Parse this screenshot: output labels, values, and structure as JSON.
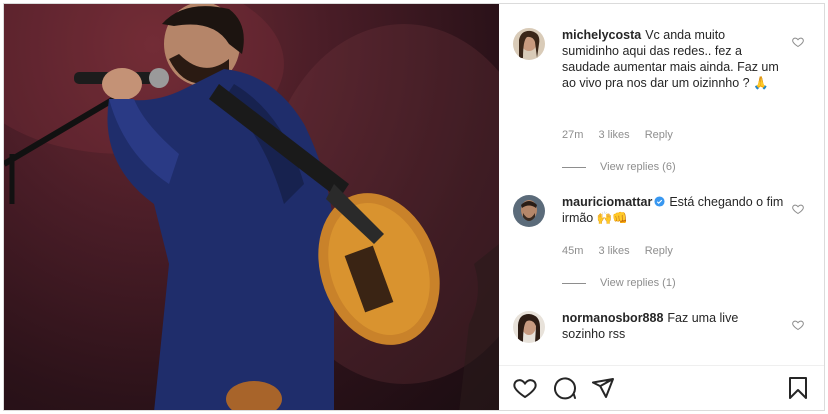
{
  "post": {
    "image_alt": "Singer on stage holding a microphone with an acoustic guitar on his back"
  },
  "comments": [
    {
      "username": "michelycosta",
      "text": "Vc anda muito sumidinho aqui das redes.. fez a saudade aumentar mais ainda. Faz um ao vivo pra nos dar um oizinnho ? 🙏",
      "time": "27m",
      "likes": "3 likes",
      "reply": "Reply",
      "view_replies": "View replies (6)"
    },
    {
      "username": "mauriciomattar",
      "text": "Está chegando o fim irmão 🙌👊",
      "time": "45m",
      "likes": "3 likes",
      "reply": "Reply",
      "view_replies": "View replies (1)"
    },
    {
      "username": "normanosbor888",
      "text": "Faz uma live sozinho rss"
    }
  ],
  "icons": {
    "like": "heart-icon",
    "comment": "comment-icon",
    "share": "paper-plane-icon",
    "save": "bookmark-icon",
    "verified": "verified-badge-icon"
  },
  "colors": {
    "verified": "#3897f0",
    "muted": "#8e8e8e",
    "text": "#262626"
  }
}
